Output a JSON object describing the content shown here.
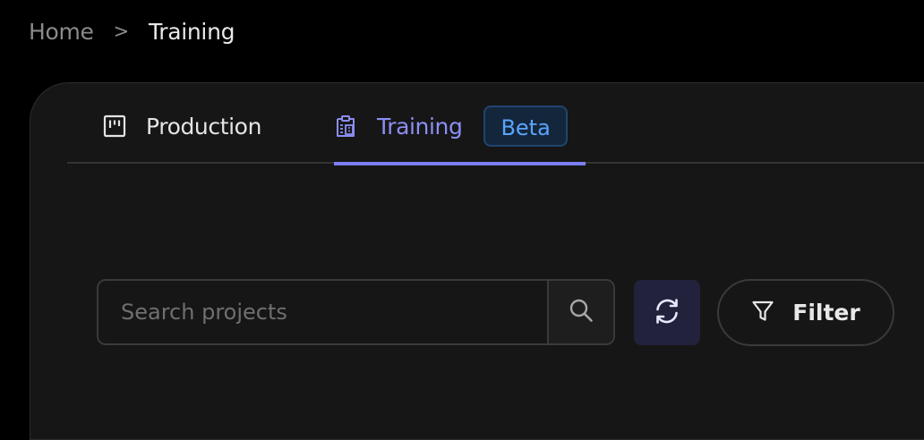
{
  "breadcrumb": {
    "home": "Home",
    "separator": ">",
    "current": "Training"
  },
  "tabs": [
    {
      "label": "Production",
      "icon": "board-icon",
      "active": false
    },
    {
      "label": "Training",
      "icon": "clipboard-building-icon",
      "active": true,
      "badge": "Beta"
    }
  ],
  "search": {
    "placeholder": "Search projects",
    "value": ""
  },
  "filter": {
    "label": "Filter"
  },
  "colors": {
    "accent": "#7c7ff0",
    "badge_text": "#5aa4ff",
    "badge_bg": "#14263c",
    "panel_bg": "#161616",
    "page_bg": "#000000"
  }
}
